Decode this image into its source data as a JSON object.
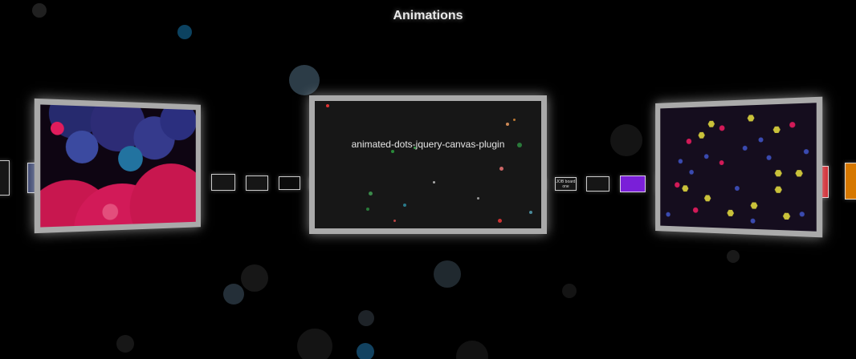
{
  "page": {
    "title": "Animations"
  },
  "center_card": {
    "caption": "animated-dots-jquery-canvas-plugin"
  },
  "thumbnails": {
    "small_label": "JOB board one"
  },
  "colors": {
    "pink": "#d21a58",
    "navy": "#2b2f8f",
    "purple": "#7a1fd8",
    "red": "#cc1a22",
    "orange": "#d67800"
  }
}
